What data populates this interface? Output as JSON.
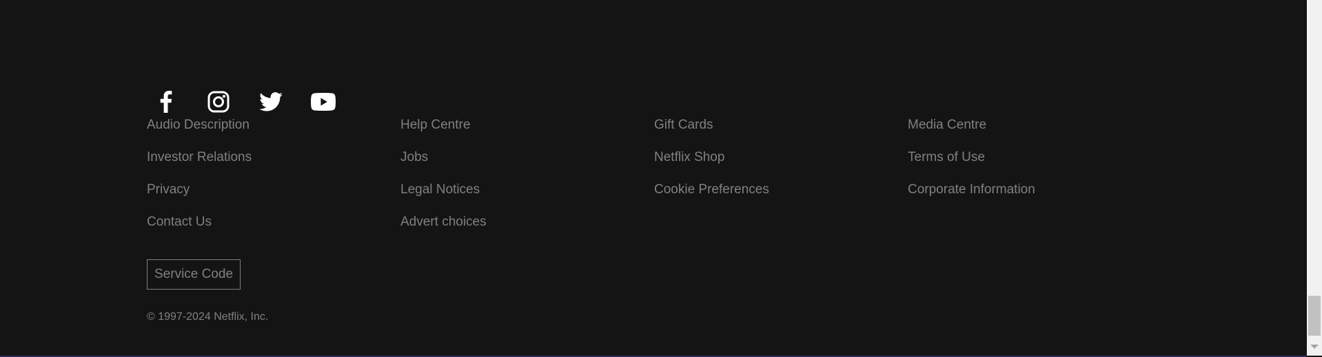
{
  "social": [
    {
      "name": "facebook-icon",
      "label": "Facebook"
    },
    {
      "name": "instagram-icon",
      "label": "Instagram"
    },
    {
      "name": "twitter-icon",
      "label": "Twitter"
    },
    {
      "name": "youtube-icon",
      "label": "YouTube"
    }
  ],
  "links": [
    [
      "Audio Description",
      "Help Centre",
      "Gift Cards",
      "Media Centre"
    ],
    [
      "Investor Relations",
      "Jobs",
      "Netflix Shop",
      "Terms of Use"
    ],
    [
      "Privacy",
      "Legal Notices",
      "Cookie Preferences",
      "Corporate Information"
    ],
    [
      "Contact Us",
      "Advert choices"
    ]
  ],
  "footer": {
    "service_code_label": "Service Code",
    "copyright": "© 1997-2024 Netflix, Inc."
  },
  "colors": {
    "background": "#141414",
    "link": "#808080",
    "icon": "#ffffff"
  }
}
